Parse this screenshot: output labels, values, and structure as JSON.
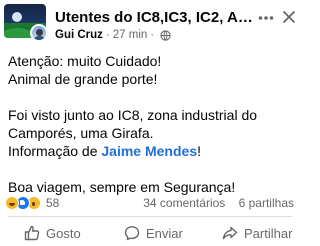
{
  "post": {
    "group_name": "Utentes do IC8,IC3, IC2, A1...",
    "author": "Gui Cruz",
    "separator": "·",
    "time": "27 min",
    "privacy_icon": "globe-icon",
    "message": {
      "line1": "Atenção: muito Cuidado!",
      "line2": "Animal de grande porte!",
      "line3": "Foi visto junto ao IC8, zona industrial do",
      "line4": "Camporés,  uma Girafa.",
      "line5_prefix": "Informação de ",
      "mention": "Jaime Mendes",
      "line5_suffix": "!",
      "line6": "Boa viagem, sempre em Segurança!"
    },
    "reactions": {
      "icons": [
        "haha-reaction-icon",
        "like-reaction-icon",
        "wow-reaction-icon"
      ],
      "count": "58"
    },
    "comments_count": "34 comentários",
    "shares_count": "6 partilhas"
  },
  "actions": {
    "like_label": "Gosto",
    "comment_label": "Enviar",
    "share_label": "Partilhar"
  },
  "colors": {
    "mention": "#216fdb",
    "secondary_text": "#65676b",
    "primary_text": "#050505"
  }
}
